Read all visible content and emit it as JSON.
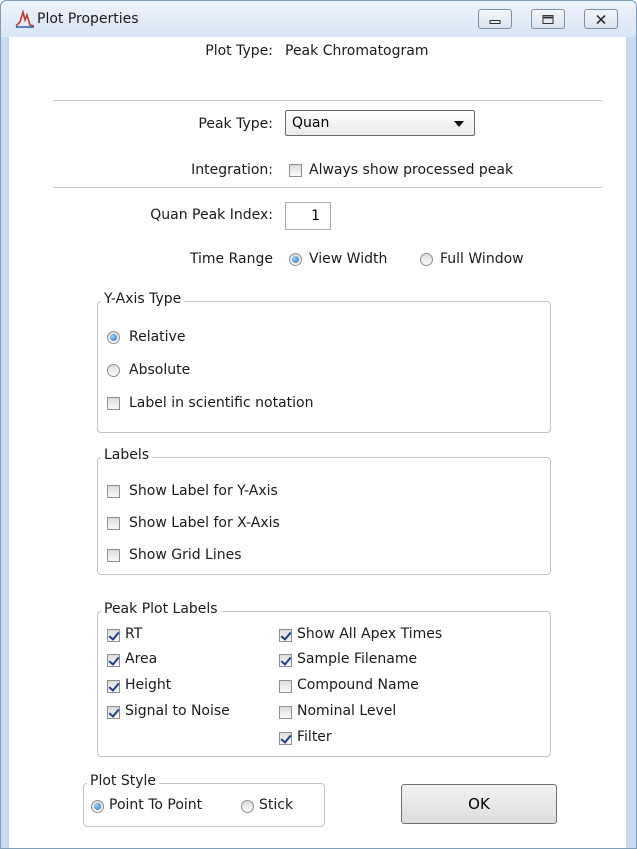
{
  "window": {
    "title": "Plot Properties",
    "title_icon": "peak-chart-icon",
    "controls": [
      "minimize-icon",
      "maximize-icon",
      "close-icon"
    ]
  },
  "plot_type": {
    "label": "Plot Type:",
    "value": "Peak Chromatogram"
  },
  "peak_type": {
    "label": "Peak Type:",
    "selected": "Quan"
  },
  "integration": {
    "label": "Integration:",
    "checkbox_label": "Always show processed peak",
    "checked": false
  },
  "quan_peak_index": {
    "label": "Quan Peak Index:",
    "value": "1"
  },
  "time_range": {
    "label": "Time Range",
    "options": [
      {
        "label": "View Width",
        "selected": true
      },
      {
        "label": "Full Window",
        "selected": false
      }
    ]
  },
  "y_axis_type": {
    "title": "Y-Axis Type",
    "relative": {
      "label": "Relative",
      "selected": true
    },
    "absolute": {
      "label": "Absolute",
      "selected": false
    },
    "scientific": {
      "label": "Label in scientific notation",
      "checked": false
    }
  },
  "labels": {
    "title": "Labels",
    "items": [
      {
        "label": "Show Label for Y-Axis",
        "checked": false
      },
      {
        "label": "Show Label for X-Axis",
        "checked": false
      },
      {
        "label": "Show Grid Lines",
        "checked": false
      }
    ]
  },
  "peak_plot_labels": {
    "title": "Peak Plot Labels",
    "left": [
      {
        "label": "RT",
        "checked": true
      },
      {
        "label": "Area",
        "checked": true
      },
      {
        "label": "Height",
        "checked": true
      },
      {
        "label": "Signal to Noise",
        "checked": true
      }
    ],
    "right": [
      {
        "label": "Show All Apex Times",
        "checked": true
      },
      {
        "label": "Sample Filename",
        "checked": true
      },
      {
        "label": "Compound Name",
        "checked": false
      },
      {
        "label": "Nominal Level",
        "checked": false
      },
      {
        "label": "Filter",
        "checked": true
      }
    ]
  },
  "plot_style": {
    "title": "Plot Style",
    "options": [
      {
        "label": "Point To Point",
        "selected": true
      },
      {
        "label": "Stick",
        "selected": false
      }
    ]
  },
  "ok_button": {
    "label": "OK"
  }
}
